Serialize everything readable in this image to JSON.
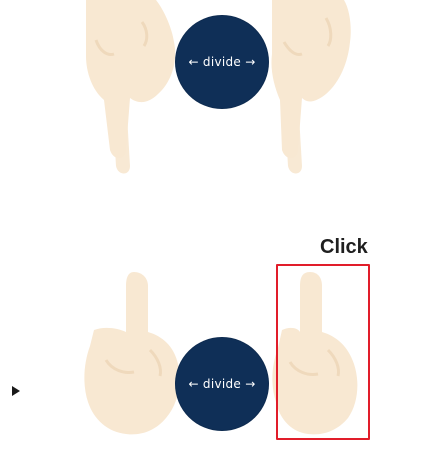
{
  "top_panel": {
    "divide_button": {
      "label": "← divide →"
    }
  },
  "bottom_panel": {
    "divide_button": {
      "label": "← divide →"
    },
    "click_label": "Click"
  },
  "colors": {
    "circle_fill": "#0f2f57",
    "hand_fill": "#f8e8d2",
    "highlight_border": "#e11d2a"
  },
  "icons": [
    "play-icon"
  ]
}
